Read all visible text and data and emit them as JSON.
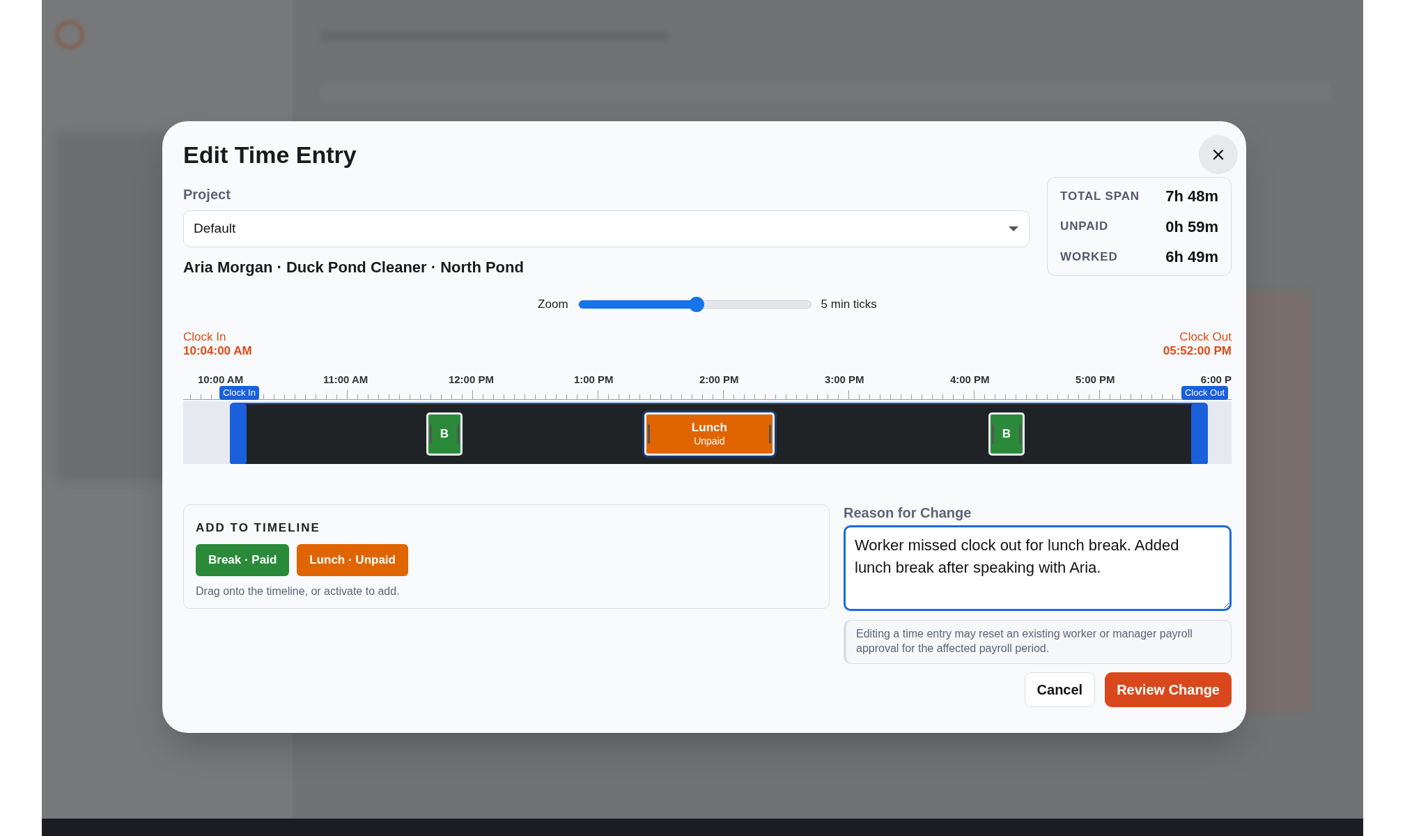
{
  "dialog": {
    "title": "Edit Time Entry",
    "project": {
      "label": "Project",
      "value": "Default"
    },
    "summary": "Aria Morgan · Duck Pond Cleaner · North Pond",
    "stats": [
      {
        "label": "TOTAL SPAN",
        "value": "7h 48m"
      },
      {
        "label": "UNPAID",
        "value": "0h 59m"
      },
      {
        "label": "WORKED",
        "value": "6h 49m"
      }
    ],
    "zoom": {
      "label": "Zoom",
      "level": 0.51,
      "reading": "5 min ticks"
    },
    "clock_in": {
      "label": "Clock In",
      "time": "10:04:00 AM",
      "badge": "Clock In"
    },
    "clock_out": {
      "label": "Clock Out",
      "time": "05:52:00 PM",
      "badge": "Clock Out"
    },
    "ticks": [
      "10:00 AM",
      "11:00 AM",
      "12:00 PM",
      "1:00 PM",
      "2:00 PM",
      "3:00 PM",
      "4:00 PM",
      "5:00 PM",
      "6:00 P"
    ],
    "segments": [
      {
        "kind": "break",
        "label": "B"
      },
      {
        "kind": "lunch",
        "label": "Lunch",
        "sublabel": "Unpaid"
      },
      {
        "kind": "break",
        "label": "B"
      }
    ],
    "add_panel": {
      "title": "ADD TO TIMELINE",
      "items": [
        {
          "kind": "break",
          "label": "Break · Paid"
        },
        {
          "kind": "lunch",
          "label": "Lunch · Unpaid"
        }
      ],
      "hint": "Drag onto the timeline, or activate to add."
    },
    "reason": {
      "label": "Reason for Change",
      "value": "Worker missed clock out for lunch break. Added lunch break after speaking with Aria."
    },
    "notice": "Editing a time entry may reset an existing worker or manager payroll approval for the affected payroll period.",
    "buttons": [
      {
        "kind": "secondary",
        "label": "Cancel"
      },
      {
        "kind": "primary",
        "label": "Review Change"
      }
    ]
  }
}
